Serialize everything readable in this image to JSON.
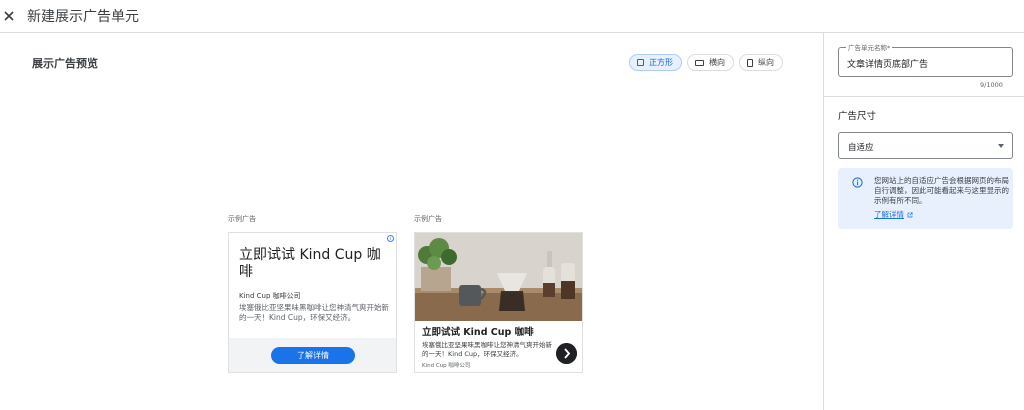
{
  "header": {
    "title": "新建展示广告单元",
    "close_icon": "close-icon"
  },
  "preview": {
    "section_title": "展示广告预览",
    "format_chips": [
      {
        "label": "正方形",
        "icon": "square-icon",
        "selected": true
      },
      {
        "label": "横向",
        "icon": "landscape-icon",
        "selected": false
      },
      {
        "label": "纵向",
        "icon": "portrait-icon",
        "selected": false
      }
    ],
    "text_ad": {
      "label": "示例广告",
      "headline": "立即试试 Kind Cup 咖啡",
      "advertiser": "Kind Cup 咖啡公司",
      "description": "埃塞俄比亚坚果味黑咖啡让您神清气爽开始新的一天！Kind Cup，环保又经济。",
      "cta": "了解详情"
    },
    "image_ad": {
      "label": "示例广告",
      "headline": "立即试试 Kind Cup 咖啡",
      "description": "埃塞俄比亚坚果味黑咖啡让您神清气爽开始新的一天！Kind Cup，环保又经济。",
      "advertiser": "Kind Cup 咖啡公司"
    }
  },
  "settings": {
    "name_field": {
      "label": "广告单元名称*",
      "value": "文章详情页底部广告",
      "counter": "9/1000"
    },
    "size_title": "广告尺寸",
    "size_select": {
      "value": "自适应"
    },
    "info": {
      "text": "您网站上的自适应广告会根据网页的布局自行调整，因此可能看起来与这里显示的示例有所不同。",
      "link": "了解详情"
    }
  },
  "colors": {
    "accent": "#1a73e8",
    "info_bg": "#e8f0fe",
    "chip_active_bg": "#e8f0fe"
  }
}
